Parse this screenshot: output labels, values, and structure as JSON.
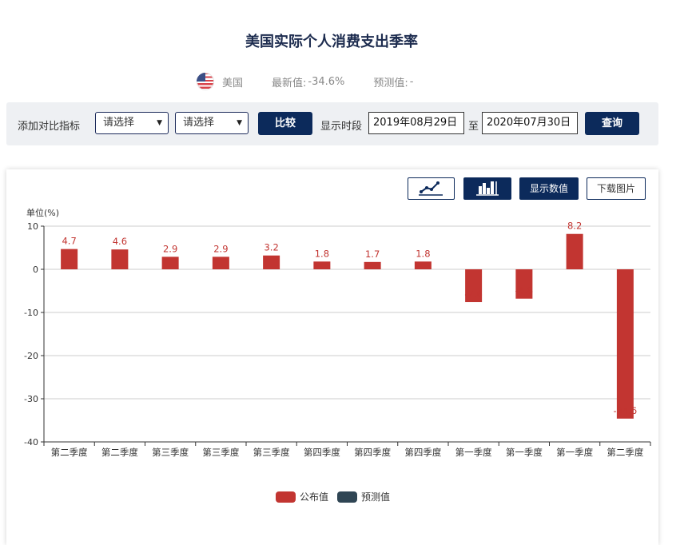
{
  "page": {
    "title": "美国实际个人消费支出季率",
    "country": "美国",
    "latest_label": "最新值:",
    "latest_value": "-34.6%",
    "forecast_label": "预测值:",
    "forecast_value": "-"
  },
  "toolbar": {
    "compare_label": "添加对比指标",
    "select1": "请选择",
    "select2": "请选择",
    "compare_button": "比较",
    "period_label": "显示时段",
    "start_date": "2019年08月29日",
    "to_label": "至",
    "end_date": "2020年07月30日",
    "query_button": "查询"
  },
  "chart_controls": {
    "show_values": "显示数值",
    "download": "下载图片"
  },
  "icons": [
    "flag-us-icon",
    "chevron-down-icon",
    "line-chart-icon",
    "bar-chart-icon"
  ],
  "colors": {
    "published": "#c23531",
    "forecast": "#2f4554",
    "accent": "#0c2a5b"
  },
  "chart_data": {
    "type": "bar",
    "ylabel": "单位(%)",
    "ylim": [
      -40,
      10
    ],
    "yticks": [
      10,
      0,
      -10,
      -20,
      -30,
      -40
    ],
    "categories": [
      "第二季度",
      "第二季度",
      "第三季度",
      "第三季度",
      "第三季度",
      "第四季度",
      "第四季度",
      "第四季度",
      "第一季度",
      "第一季度",
      "第一季度",
      "第二季度"
    ],
    "series": [
      {
        "name": "公布值",
        "color": "#c23531",
        "values": [
          4.7,
          4.6,
          2.9,
          2.9,
          3.2,
          1.8,
          1.7,
          1.8,
          -7.6,
          -6.8,
          8.2,
          -34.6
        ]
      },
      {
        "name": "预测值",
        "color": "#2f4554",
        "values": []
      }
    ],
    "grid": true,
    "legend": "bottom-center"
  }
}
